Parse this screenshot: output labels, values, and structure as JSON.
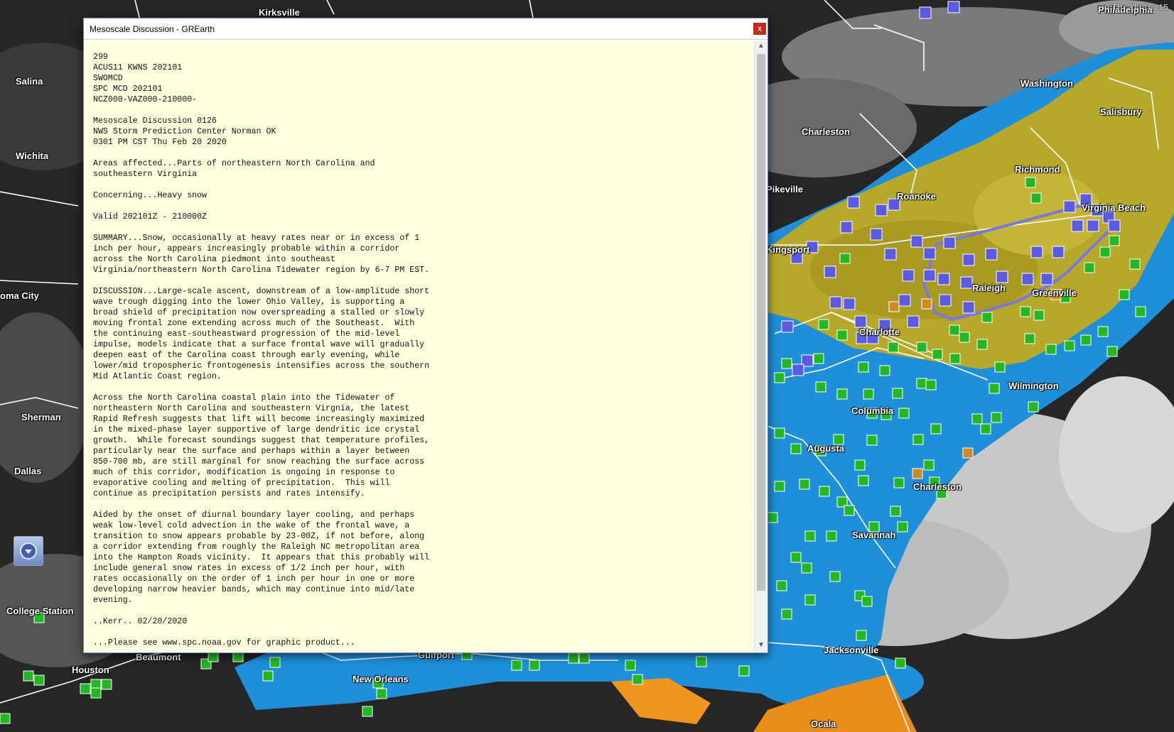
{
  "window": {
    "title": "Mesoscale Discussion - GREarth",
    "close_label": "x",
    "body_text": "299\nACUS11 KWNS 202101\nSWOMCD\nSPC MCD 202101\nNCZ000-VAZ000-210000-\n\nMesoscale Discussion 0126\nNWS Storm Prediction Center Norman OK\n0301 PM CST Thu Feb 20 2020\n\nAreas affected...Parts of northeastern North Carolina and\nsoutheastern Virginia\n\nConcerning...Heavy snow\n\nValid 202101Z - 210000Z\n\nSUMMARY...Snow, occasionally at heavy rates near or in excess of 1\ninch per hour, appears increasingly probable within a corridor\nacross the North Carolina piedmont into southeast\nVirginia/northeastern North Carolina Tidewater region by 6-7 PM EST.\n\nDISCUSSION...Large-scale ascent, downstream of a low-amplitude short\nwave trough digging into the lower Ohio Valley, is supporting a\nbroad shield of precipitation now overspreading a stalled or slowly\nmoving frontal zone extending across much of the Southeast.  With\nthe continuing east-southeastward progression of the mid-level\nimpulse, models indicate that a surface frontal wave will gradually\ndeepen east of the Carolina coast through early evening, while\nlower/mid tropospheric frontogenesis intensifies across the southern\nMid Atlantic Coast region.\n\nAcross the North Carolina coastal plain into the Tidewater of\nnortheastern North Carolina and southeastern Virgnia, the latest\nRapid Refresh suggests that lift will become increasingly maximized\nin the mixed-phase layer supportive of large dendritic ice crystal\ngrowth.  While forecast soundings suggest that temperature profiles,\nparticularly near the surface and perhaps within a layer between\n850-700 mb, are still marginal for snow reaching the surface across\nmuch of this corridor, modification is ongoing in response to\nevaporative cooling and melting of precipitation.  This will\ncontinue as precipitation persists and rates intensify.\n\nAided by the onset of diurnal boundary layer cooling, and perhaps\nweak low-level cold advection in the wake of the frontal wave, a\ntransition to snow appears probable by 23-00Z, if not before, along\na corridor extending from roughly the Raleigh NC metropolitan area\ninto the Hampton Roads vicinity.  It appears that this probably will\ninclude general snow rates in excess of 1/2 inch per hour, with\nrates occasionally on the order of 1 inch per hour in one or more\ndeveloping narrow heavier bands, which may continue into mid/late\nevening.\n\n..Kerr.. 02/20/2020\n\n...Please see www.spc.noaa.gov for graphic product..."
  },
  "map": {
    "timestamp": "Th 21:16:15",
    "cities": [
      {
        "name": "Kirksville"
      },
      {
        "name": "Salina"
      },
      {
        "name": "Wichita"
      },
      {
        "name": "oma City"
      },
      {
        "name": "Sherman"
      },
      {
        "name": "Dallas"
      },
      {
        "name": "College Station"
      },
      {
        "name": "Houston"
      },
      {
        "name": "Beaumont"
      },
      {
        "name": "Gulfport"
      },
      {
        "name": "New Orleans"
      },
      {
        "name": "Philadelphia"
      },
      {
        "name": "Washington"
      },
      {
        "name": "Salisbury"
      },
      {
        "name": "Charleston"
      },
      {
        "name": "Richmond"
      },
      {
        "name": "Pikeville"
      },
      {
        "name": "Roanoke"
      },
      {
        "name": "Virginia Beach"
      },
      {
        "name": "Kingsport"
      },
      {
        "name": "Raleigh"
      },
      {
        "name": "Greenville"
      },
      {
        "name": "Charlotte"
      },
      {
        "name": "Wilmington"
      },
      {
        "name": "Columbia"
      },
      {
        "name": "Augusta"
      },
      {
        "name": "Charleston"
      },
      {
        "name": "Savannah"
      },
      {
        "name": "Jacksonville"
      },
      {
        "name": "Ocala"
      }
    ],
    "nav_icon": "arrow-down-icon",
    "colors": {
      "snow_zone": "#b5a82a",
      "rain_zone": "#1e8fd8",
      "mix_zone": "#f0961e",
      "md_outline": "#7b78d8"
    }
  }
}
